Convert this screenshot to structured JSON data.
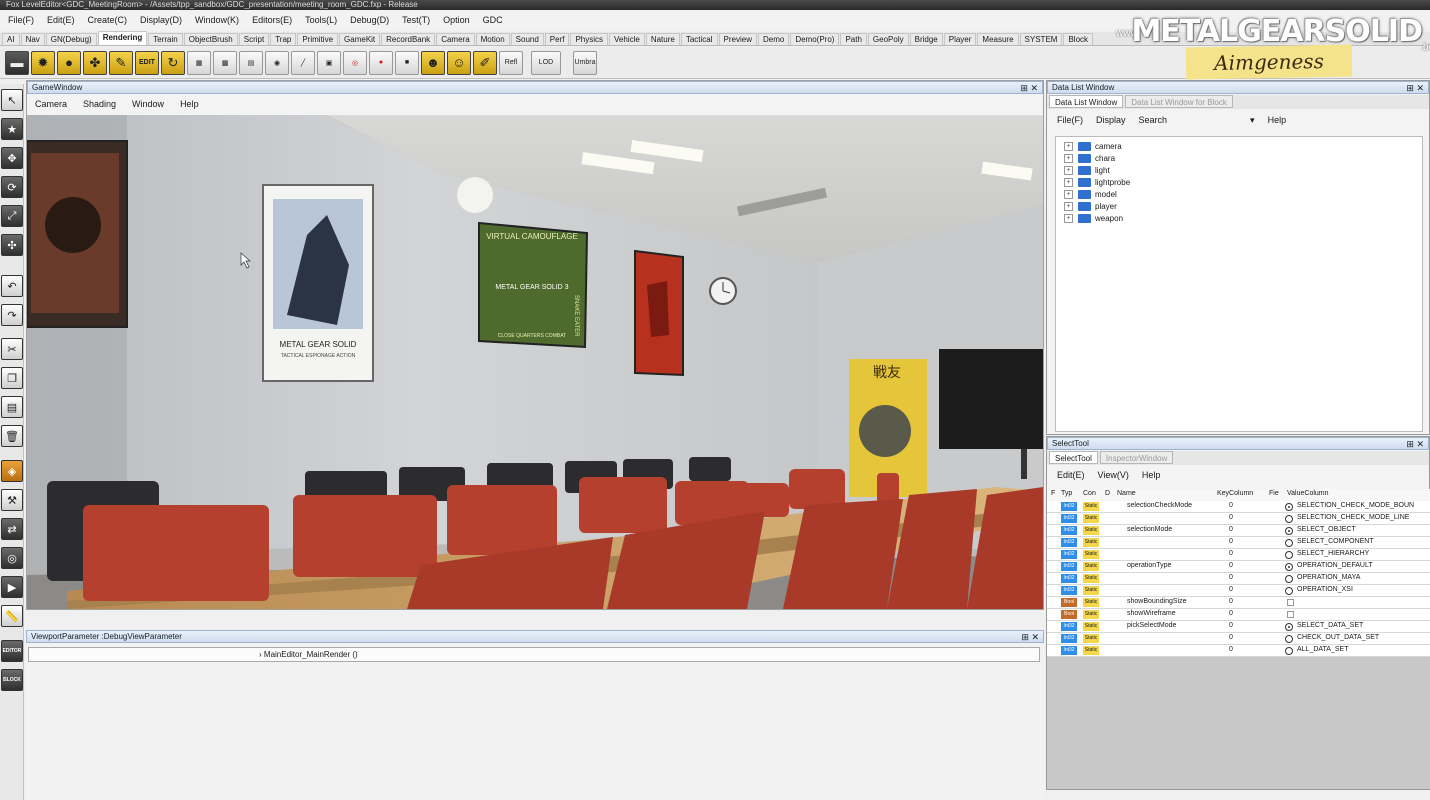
{
  "titlebar": {
    "text": "Fox LevelEditor<GDC_MeetingRoom> - /Assets/tpp_sandbox/GDC_presentation/meeting_room_GDC.fxp - Release"
  },
  "menubar": [
    "File(F)",
    "Edit(E)",
    "Create(C)",
    "Display(D)",
    "Window(K)",
    "Editors(E)",
    "Tools(L)",
    "Debug(D)",
    "Test(T)",
    "Option",
    "GDC"
  ],
  "tabs": [
    "AI",
    "Nav",
    "GN(Debug)",
    "Rendering",
    "Terrain",
    "ObjectBrush",
    "Script",
    "Trap",
    "Primitive",
    "GameKit",
    "RecordBank",
    "Camera",
    "Motion",
    "Sound",
    "Perf",
    "Physics",
    "Vehicle",
    "Nature",
    "Tactical",
    "Preview",
    "Demo",
    "Demo(Pro)",
    "Path",
    "GeoPoly",
    "Bridge",
    "Player",
    "Measure",
    "SYSTEM",
    "Block"
  ],
  "active_tab": "Rendering",
  "toolbar": {
    "edit_label": "EDIT",
    "refl_label": "Refl",
    "lod_label": "LOD",
    "umbra_label": "Umbra"
  },
  "logo": {
    "www": "www.",
    "main": "METALGEARSOLID",
    "tld": ".be",
    "tag": "Aimgeness"
  },
  "lefttools": {
    "editor_label": "EDITOR",
    "block_label": "BLOCK"
  },
  "gamewindow": {
    "title": "GameWindow",
    "menu": [
      "Camera",
      "Shading",
      "Window",
      "Help"
    ],
    "posters": {
      "mgs1_title": "METAL GEAR SOLID",
      "mgs1_sub": "TACTICAL ESPIONAGE ACTION",
      "mgs3_banner": "VIRTUAL CAMOUFLAGE",
      "mgs3_side": "SNAKE EATER",
      "mgs3_title": "METAL GEAR SOLID 3",
      "mgs3_bottom": "CLOSE QUARTERS COMBAT",
      "kanji": "戦友"
    }
  },
  "viewport_param": {
    "title": "ViewportParameter :DebugViewParameter",
    "row": "MainEditor_MainRender ()"
  },
  "datalist": {
    "title": "Data List Window",
    "tabs": [
      "Data List Window",
      "Data List Window for Block"
    ],
    "menu": [
      "File(F)",
      "Display",
      "Search",
      "Help"
    ],
    "tree": [
      "camera",
      "chara",
      "light",
      "lightprobe",
      "model",
      "player",
      "weapon"
    ]
  },
  "selecttool": {
    "title": "SelectTool",
    "tabs": [
      "SelectTool",
      "InspectorWindow"
    ],
    "menu": [
      "Edit(E)",
      "View(V)",
      "Help"
    ],
    "columns": [
      "F",
      "Typ",
      "Con",
      "D",
      "Name",
      "KeyColumn",
      "Fie",
      "ValueColumn"
    ],
    "rows": [
      {
        "type": "Int32",
        "cond": "Static",
        "name": "selectionCheckMode",
        "key": "0",
        "ctrl": "radio-on",
        "value": "SELECTION_CHECK_MODE_BOUN"
      },
      {
        "type": "Int32",
        "cond": "Static",
        "name": "",
        "key": "0",
        "ctrl": "radio",
        "value": "SELECTION_CHECK_MODE_LINE"
      },
      {
        "type": "Int32",
        "cond": "Static",
        "name": "selectionMode",
        "key": "0",
        "ctrl": "radio-on",
        "value": "SELECT_OBJECT"
      },
      {
        "type": "Int32",
        "cond": "Static",
        "name": "",
        "key": "0",
        "ctrl": "radio",
        "value": "SELECT_COMPONENT"
      },
      {
        "type": "Int32",
        "cond": "Static",
        "name": "",
        "key": "0",
        "ctrl": "radio",
        "value": "SELECT_HIERARCHY"
      },
      {
        "type": "Int32",
        "cond": "Static",
        "name": "operationType",
        "key": "0",
        "ctrl": "radio-on",
        "value": "OPERATION_DEFAULT"
      },
      {
        "type": "Int32",
        "cond": "Static",
        "name": "",
        "key": "0",
        "ctrl": "radio",
        "value": "OPERATION_MAYA"
      },
      {
        "type": "Int32",
        "cond": "Static",
        "name": "",
        "key": "0",
        "ctrl": "radio",
        "value": "OPERATION_XSI"
      },
      {
        "type": "Bool",
        "cond": "Static",
        "name": "showBoundingSize",
        "key": "0",
        "ctrl": "check",
        "value": ""
      },
      {
        "type": "Bool",
        "cond": "Static",
        "name": "showWireframe",
        "key": "0",
        "ctrl": "check",
        "value": ""
      },
      {
        "type": "Int32",
        "cond": "Static",
        "name": "pickSelectMode",
        "key": "0",
        "ctrl": "radio-on",
        "value": "SELECT_DATA_SET"
      },
      {
        "type": "Int32",
        "cond": "Static",
        "name": "",
        "key": "0",
        "ctrl": "radio",
        "value": "CHECK_OUT_DATA_SET"
      },
      {
        "type": "Int32",
        "cond": "Static",
        "name": "",
        "key": "0",
        "ctrl": "radio",
        "value": "ALL_DATA_SET"
      }
    ]
  },
  "colors": {
    "panel_head": "#cfdcee",
    "tree_folder": "#2e6fd0",
    "int_type": "#2f8fe8",
    "bool_type": "#c46a2a",
    "static_cond": "#f4d64c",
    "chair_red": "#b5402e",
    "table_wood": "#c9a064"
  }
}
